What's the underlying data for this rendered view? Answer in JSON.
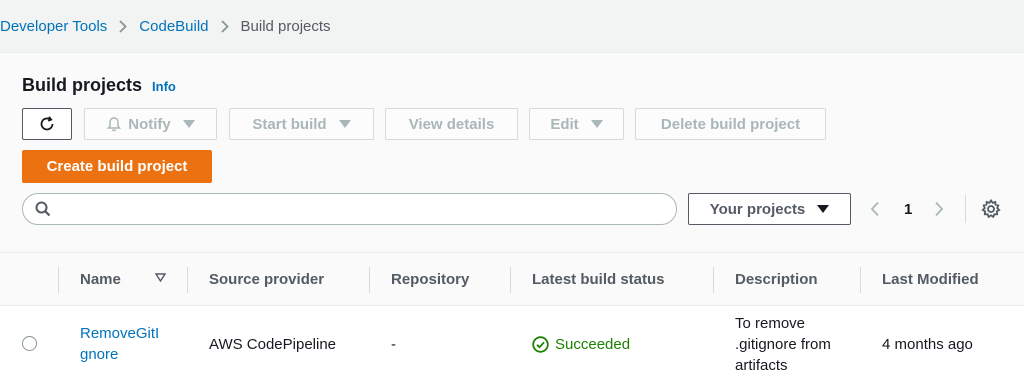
{
  "breadcrumb": {
    "items": [
      "Developer Tools",
      "CodeBuild",
      "Build projects"
    ]
  },
  "panel": {
    "title": "Build projects",
    "info_label": "Info"
  },
  "toolbar": {
    "notify_label": "Notify",
    "start_build_label": "Start build",
    "view_details_label": "View details",
    "edit_label": "Edit",
    "delete_label": "Delete build project",
    "create_label": "Create build project"
  },
  "search": {
    "value": "",
    "placeholder": ""
  },
  "filter": {
    "selected": "Your projects"
  },
  "pagination": {
    "current_page": "1"
  },
  "table": {
    "columns": [
      "Name",
      "Source provider",
      "Repository",
      "Latest build status",
      "Description",
      "Last Modified"
    ],
    "rows": [
      {
        "name_line1": "RemoveGitI",
        "name_line2": "gnore",
        "source_provider": "AWS CodePipeline",
        "repository": "-",
        "status": "Succeeded",
        "description_line1": "To remove",
        "description_line2": ".gitignore from",
        "description_line3": "artifacts",
        "last_modified": "4 months ago"
      }
    ]
  },
  "colors": {
    "link": "#0073bb",
    "primary": "#ec7211",
    "success": "#1d8102",
    "disabled": "#aab7b8"
  },
  "icons": [
    "chevron-right-icon",
    "refresh-icon",
    "bell-icon",
    "caret-down-icon",
    "search-icon",
    "chevron-left-icon",
    "gear-icon",
    "sort-icon",
    "success-icon"
  ]
}
